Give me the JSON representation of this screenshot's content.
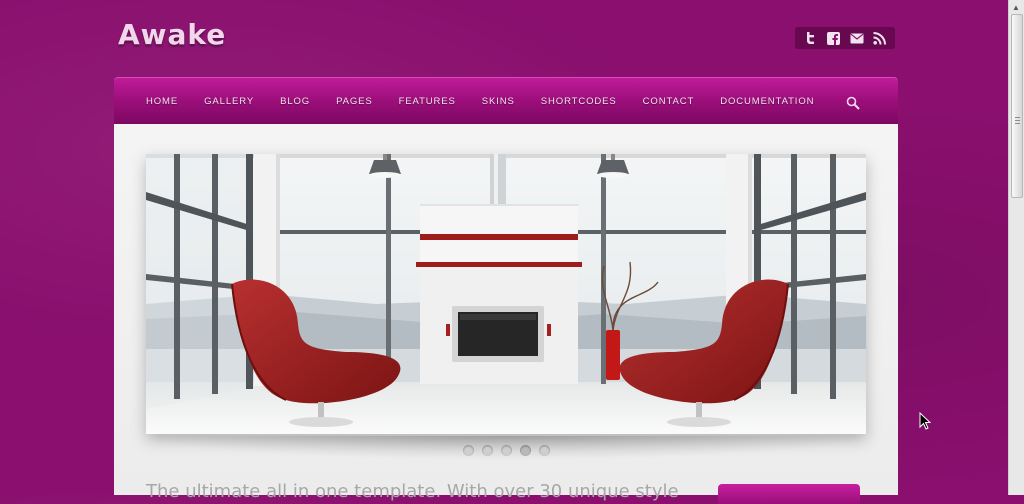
{
  "site": {
    "logo": "Awake"
  },
  "header": {
    "social": [
      {
        "icon": "twitter-icon"
      },
      {
        "icon": "facebook-icon"
      },
      {
        "icon": "email-icon"
      },
      {
        "icon": "rss-icon"
      }
    ]
  },
  "nav": {
    "items": [
      "HOME",
      "GALLERY",
      "BLOG",
      "PAGES",
      "FEATURES",
      "SKINS",
      "SHORTCODES",
      "CONTACT",
      "DOCUMENTATION"
    ],
    "search_icon": "search-icon"
  },
  "slider": {
    "slide_count": 5,
    "active_index": 3
  },
  "intro": {
    "text": "The ultimate all in one template. With over 30 unique style"
  },
  "colors": {
    "accent": "#a0107f",
    "background": "#8a0f6e",
    "chair": "#a11d1d"
  }
}
